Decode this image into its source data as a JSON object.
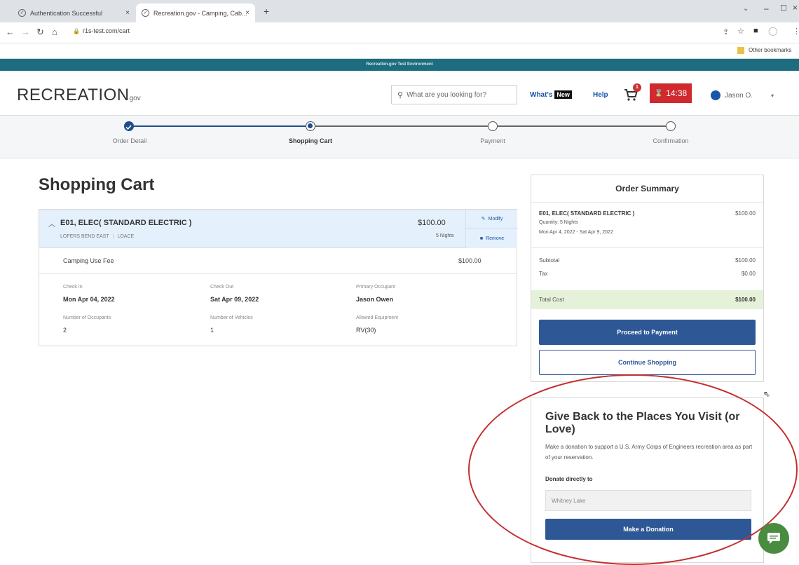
{
  "browser": {
    "tabs": [
      {
        "title": "Authentication Successful",
        "close": "×"
      },
      {
        "title": "Recreation.gov - Camping, Cab...",
        "close": "×"
      }
    ],
    "new_tab": "+",
    "url": "r1s-test.com/cart",
    "other_bookmarks": "Other bookmarks"
  },
  "site": {
    "env_banner": "Recreation.gov Test Environment",
    "logo_main": "RECREATION",
    "logo_suffix": "gov",
    "search_placeholder": "What are you looking for?",
    "whats": "What's",
    "new_badge": "New",
    "help": "Help",
    "cart_count": "1",
    "timer": "14:38",
    "user": "Jason O.",
    "colors": {
      "env": "#1b6d7f",
      "timer": "#d0292e",
      "primary": "#2e5796",
      "total_row": "#e5f1d9"
    }
  },
  "progress": {
    "steps": [
      {
        "label": "Order Detail",
        "state": "done"
      },
      {
        "label": "Shopping Cart",
        "state": "current"
      },
      {
        "label": "Payment",
        "state": "todo"
      },
      {
        "label": "Confirmation",
        "state": "todo"
      }
    ]
  },
  "cart": {
    "title": "Shopping Cart",
    "item": {
      "name": "E01, ELEC( STANDARD ELECTRIC )",
      "location": "LOFERS BEND EAST",
      "sub_location": "LOACE",
      "price": "$100.00",
      "nights": "5 Nights",
      "modify": "Modify",
      "remove": "Remove",
      "fee_label": "Camping Use Fee",
      "fee_value": "$100.00",
      "details": {
        "check_in_label": "Check In",
        "check_in": "Mon Apr 04, 2022",
        "check_out_label": "Check Out",
        "check_out": "Sat Apr 09, 2022",
        "occupant_label": "Primary Occupant",
        "occupant": "Jason Owen",
        "num_occupants_label": "Number of Occupants",
        "num_occupants": "2",
        "num_vehicles_label": "Number of Vehicles",
        "num_vehicles": "1",
        "equipment_label": "Allowed Equipment",
        "equipment": "RV(30)"
      }
    }
  },
  "summary": {
    "title": "Order Summary",
    "item_name": "E01, ELEC( STANDARD ELECTRIC )",
    "item_price": "$100.00",
    "quantity": "Quantity: 5 Nights",
    "dates": "Mon Apr 4, 2022 - Sat Apr 9, 2022",
    "subtotal_label": "Subtotal",
    "subtotal": "$100.00",
    "tax_label": "Tax",
    "tax": "$0.00",
    "total_label": "Total Cost",
    "total": "$100.00",
    "proceed": "Proceed to Payment",
    "continue": "Continue Shopping"
  },
  "donation": {
    "title": "Give Back to the Places You Visit (or Love)",
    "description": "Make a donation to support a U.S. Army Corps of Engineers recreation area as part of your reservation.",
    "label": "Donate directly to",
    "selected": "Whitney Lake",
    "button": "Make a Donation"
  }
}
